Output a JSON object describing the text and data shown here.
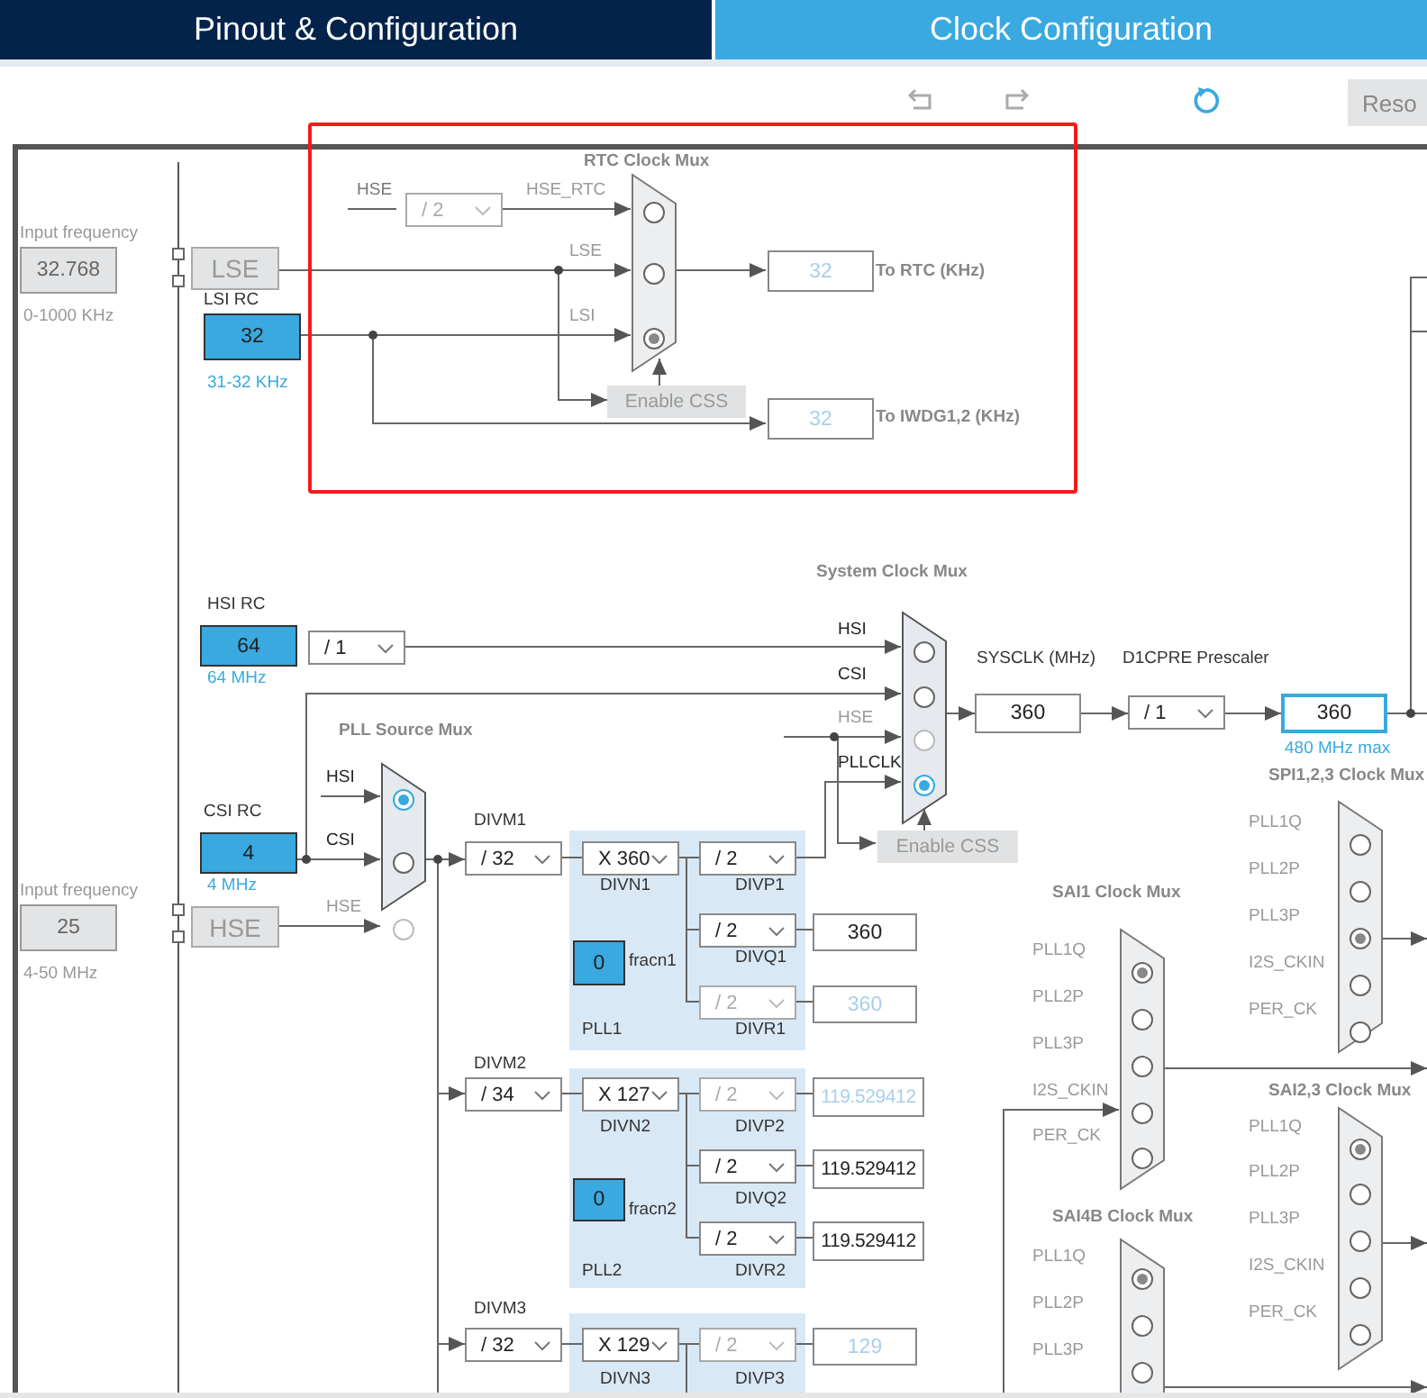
{
  "tabs": [
    {
      "label": "Pinout & Configuration",
      "selected": false
    },
    {
      "label": "Clock Configuration",
      "selected": true
    }
  ],
  "toolbar": {
    "reset_button": "Reso"
  },
  "labels": [
    {
      "text": "Input frequency",
      "kind": "freq"
    },
    {
      "text": "0-1000 KHz",
      "kind": "freq"
    },
    {
      "text": "LSI RC",
      "kind": "caption"
    },
    {
      "text": "31-32 KHz",
      "kind": "note"
    },
    {
      "text": "HSE",
      "kind": "dim"
    },
    {
      "text": "To RTC (KHz)",
      "kind": "title"
    },
    {
      "text": "To IWDG1,2 (KHz)",
      "kind": "title"
    },
    {
      "text": "HSI RC",
      "kind": "caption"
    },
    {
      "text": "64 MHz",
      "kind": "note"
    },
    {
      "text": "CSI RC",
      "kind": "caption"
    },
    {
      "text": "Input frequency",
      "kind": "freq"
    },
    {
      "text": "4 MHz",
      "kind": "note"
    },
    {
      "text": "4-50 MHz",
      "kind": "freq"
    },
    {
      "text": "SYSCLK (MHz)",
      "kind": "caption"
    },
    {
      "text": "D1CPRE Prescaler",
      "kind": "caption"
    },
    {
      "text": "480 MHz max",
      "kind": "note"
    },
    {
      "text": "DIVM1",
      "kind": "caption"
    },
    {
      "text": "DIVN1",
      "kind": "caption"
    },
    {
      "text": "DIVP1",
      "kind": "caption"
    },
    {
      "text": "DIVQ1",
      "kind": "caption"
    },
    {
      "text": "DIVR1",
      "kind": "caption"
    },
    {
      "text": "fracn1",
      "kind": "caption"
    },
    {
      "text": "PLL1",
      "kind": "caption"
    },
    {
      "text": "DIVM2",
      "kind": "caption"
    },
    {
      "text": "DIVN2",
      "kind": "caption"
    },
    {
      "text": "DIVP2",
      "kind": "caption"
    },
    {
      "text": "DIVQ2",
      "kind": "caption"
    },
    {
      "text": "DIVR2",
      "kind": "caption"
    },
    {
      "text": "fracn2",
      "kind": "caption"
    },
    {
      "text": "PLL2",
      "kind": "caption"
    },
    {
      "text": "DIVM3",
      "kind": "caption"
    },
    {
      "text": "DIVN3",
      "kind": "caption"
    },
    {
      "text": "DIVP3",
      "kind": "caption"
    }
  ],
  "values": [
    {
      "value": "32.768",
      "kind": "input"
    },
    {
      "value": "LSE",
      "kind": "osc"
    },
    {
      "value": "32",
      "kind": "source"
    },
    {
      "value": "32",
      "kind": "faded"
    },
    {
      "value": "32",
      "kind": "faded"
    },
    {
      "value": "64",
      "kind": "source"
    },
    {
      "value": "4",
      "kind": "source"
    },
    {
      "value": "25",
      "kind": "input"
    },
    {
      "value": "HSE",
      "kind": "osc"
    },
    {
      "value": "360",
      "kind": "output"
    },
    {
      "value": "360",
      "kind": "max"
    },
    {
      "value": "0",
      "kind": "source"
    },
    {
      "value": "360",
      "kind": "output"
    },
    {
      "value": "360",
      "kind": "faded"
    },
    {
      "value": "0",
      "kind": "source"
    },
    {
      "value": "119.529412",
      "kind": "faded"
    },
    {
      "value": "119.529412",
      "kind": "output"
    },
    {
      "value": "119.529412",
      "kind": "output"
    },
    {
      "value": "129",
      "kind": "faded"
    }
  ],
  "dropdowns": [
    {
      "value": "/ 2",
      "disabled": true
    },
    {
      "value": "/ 1",
      "disabled": false
    },
    {
      "value": "/ 1",
      "disabled": false
    },
    {
      "value": "/ 32",
      "disabled": false
    },
    {
      "value": "X 360",
      "disabled": false
    },
    {
      "value": "/ 2",
      "disabled": false
    },
    {
      "value": "/ 2",
      "disabled": false
    },
    {
      "value": "/ 2",
      "disabled": true
    },
    {
      "value": "/ 34",
      "disabled": false
    },
    {
      "value": "X 127",
      "disabled": false
    },
    {
      "value": "/ 2",
      "disabled": true
    },
    {
      "value": "/ 2",
      "disabled": false
    },
    {
      "value": "/ 2",
      "disabled": false
    },
    {
      "value": "/ 32",
      "disabled": false
    },
    {
      "value": "X 129",
      "disabled": false
    },
    {
      "value": "/ 2",
      "disabled": true
    }
  ],
  "buttons": [
    {
      "label": "Enable CSS",
      "disabled": true
    },
    {
      "label": "Enable CSS",
      "disabled": true
    }
  ],
  "muxes": [
    {
      "title": "RTC Clock Mux",
      "enabled": false,
      "inputs": [
        {
          "label": "HSE_RTC",
          "selected": false,
          "disabled": false
        },
        {
          "label": "LSE",
          "selected": false,
          "disabled": false
        },
        {
          "label": "LSI",
          "selected": true,
          "disabled": false
        }
      ]
    },
    {
      "title": "System Clock Mux",
      "enabled": true,
      "inputs": [
        {
          "label": "HSI",
          "selected": false,
          "disabled": false
        },
        {
          "label": "CSI",
          "selected": false,
          "disabled": false
        },
        {
          "label": "HSE",
          "selected": false,
          "disabled": true
        },
        {
          "label": "PLLCLK",
          "selected": true,
          "disabled": false
        }
      ]
    },
    {
      "title": "PLL Source Mux",
      "enabled": true,
      "inputs": [
        {
          "label": "HSI",
          "selected": true,
          "disabled": false
        },
        {
          "label": "CSI",
          "selected": false,
          "disabled": false
        },
        {
          "label": "HSE",
          "selected": false,
          "disabled": true
        }
      ]
    },
    {
      "title": "SPI1,2,3 Clock Mux",
      "enabled": false,
      "inputs": [
        {
          "label": "PLL1Q",
          "selected": false,
          "disabled": false
        },
        {
          "label": "PLL2P",
          "selected": false,
          "disabled": false
        },
        {
          "label": "PLL3P",
          "selected": true,
          "disabled": false
        },
        {
          "label": "I2S_CKIN",
          "selected": false,
          "disabled": false
        },
        {
          "label": "PER_CK",
          "selected": false,
          "disabled": false
        }
      ]
    },
    {
      "title": "SAI1 Clock Mux",
      "enabled": false,
      "inputs": [
        {
          "label": "PLL1Q",
          "selected": true,
          "disabled": false
        },
        {
          "label": "PLL2P",
          "selected": false,
          "disabled": false
        },
        {
          "label": "PLL3P",
          "selected": false,
          "disabled": false
        },
        {
          "label": "I2S_CKIN",
          "selected": false,
          "disabled": false
        },
        {
          "label": "PER_CK",
          "selected": false,
          "disabled": false
        }
      ]
    },
    {
      "title": "SAI2,3 Clock Mux",
      "enabled": false,
      "inputs": [
        {
          "label": "PLL1Q",
          "selected": true,
          "disabled": false
        },
        {
          "label": "PLL2P",
          "selected": false,
          "disabled": false
        },
        {
          "label": "PLL3P",
          "selected": false,
          "disabled": false
        },
        {
          "label": "I2S_CKIN",
          "selected": false,
          "disabled": false
        },
        {
          "label": "PER_CK",
          "selected": false,
          "disabled": false
        }
      ]
    },
    {
      "title": "SAI4B Clock Mux",
      "enabled": false,
      "inputs": [
        {
          "label": "PLL1Q",
          "selected": true,
          "disabled": false
        },
        {
          "label": "PLL2P",
          "selected": false,
          "disabled": false
        },
        {
          "label": "PLL3P",
          "selected": false,
          "disabled": false
        }
      ]
    }
  ]
}
